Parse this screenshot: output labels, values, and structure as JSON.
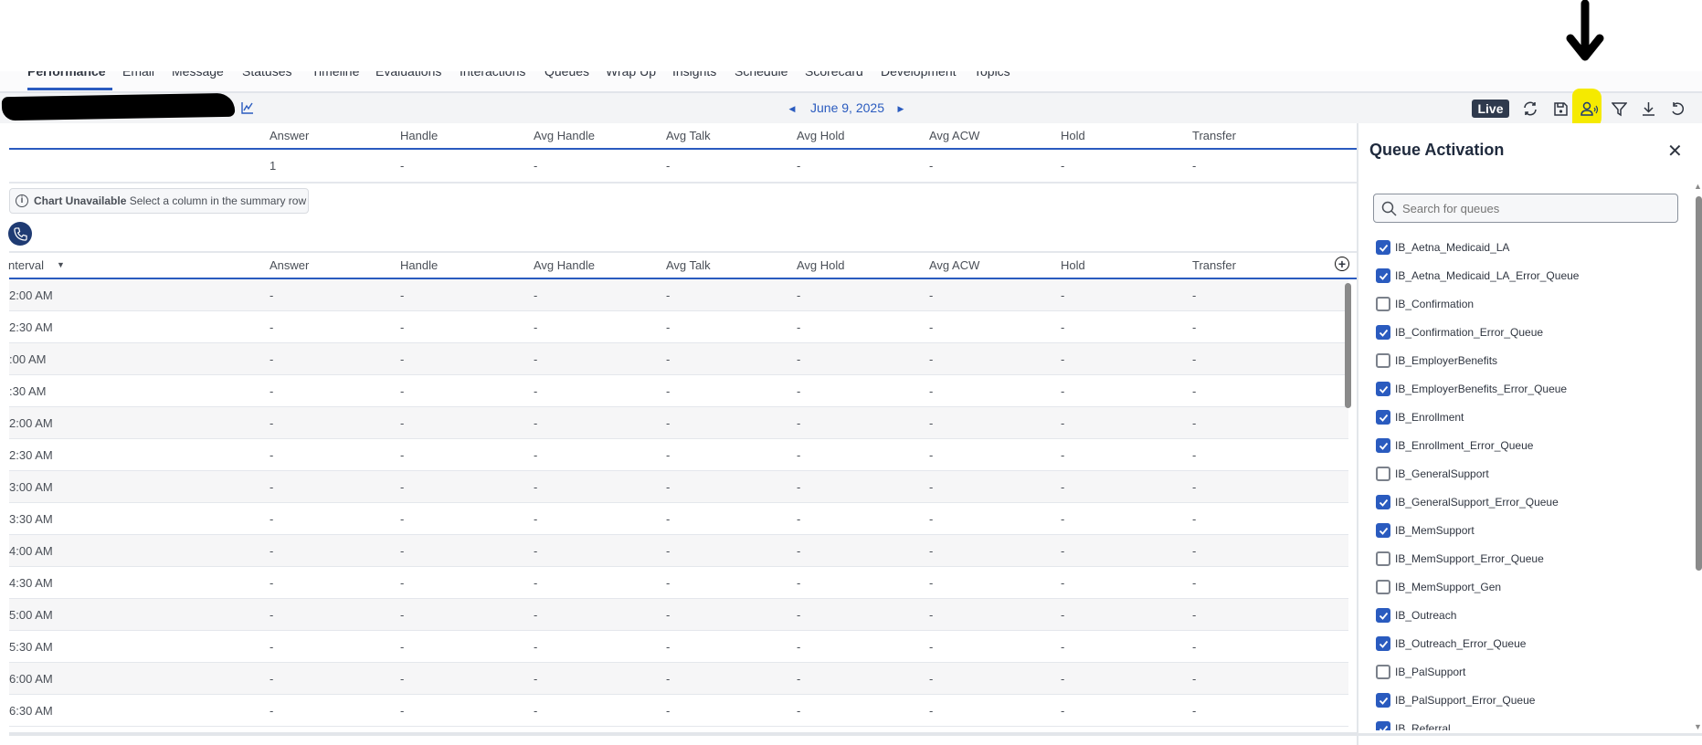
{
  "tabs": [
    "Performance",
    "Email",
    "Message",
    "Statuses",
    "Timeline",
    "Evaluations",
    "Interactions",
    "Queues",
    "Wrap Up",
    "Insights",
    "Schedule",
    "Scorecard",
    "Development",
    "Topics"
  ],
  "toolbar": {
    "date": "June 9, 2025",
    "live": "Live",
    "icons": [
      "refresh-icon",
      "save-icon",
      "queue-activation-icon",
      "filter-icon",
      "download-icon",
      "reset-icon"
    ]
  },
  "columns": [
    "Answer",
    "Handle",
    "Avg Handle",
    "Avg Talk",
    "Avg Hold",
    "Avg ACW",
    "Hold",
    "Transfer"
  ],
  "summary": {
    "values": [
      "1",
      "-",
      "-",
      "-",
      "-",
      "-",
      "-",
      "-"
    ]
  },
  "chart_notice": {
    "title": "Chart Unavailable",
    "text": "Select a column in the summary row"
  },
  "interval": {
    "header": "nterval",
    "rows": [
      {
        "label": "2:00 AM",
        "values": [
          "-",
          "-",
          "-",
          "-",
          "-",
          "-",
          "-",
          "-"
        ]
      },
      {
        "label": "2:30 AM",
        "values": [
          "-",
          "-",
          "-",
          "-",
          "-",
          "-",
          "-",
          "-"
        ]
      },
      {
        "label": ":00 AM",
        "values": [
          "-",
          "-",
          "-",
          "-",
          "-",
          "-",
          "-",
          "-"
        ]
      },
      {
        "label": ":30 AM",
        "values": [
          "-",
          "-",
          "-",
          "-",
          "-",
          "-",
          "-",
          "-"
        ]
      },
      {
        "label": "2:00 AM",
        "values": [
          "-",
          "-",
          "-",
          "-",
          "-",
          "-",
          "-",
          "-"
        ]
      },
      {
        "label": "2:30 AM",
        "values": [
          "-",
          "-",
          "-",
          "-",
          "-",
          "-",
          "-",
          "-"
        ]
      },
      {
        "label": "3:00 AM",
        "values": [
          "-",
          "-",
          "-",
          "-",
          "-",
          "-",
          "-",
          "-"
        ]
      },
      {
        "label": "3:30 AM",
        "values": [
          "-",
          "-",
          "-",
          "-",
          "-",
          "-",
          "-",
          "-"
        ]
      },
      {
        "label": "4:00 AM",
        "values": [
          "-",
          "-",
          "-",
          "-",
          "-",
          "-",
          "-",
          "-"
        ]
      },
      {
        "label": "4:30 AM",
        "values": [
          "-",
          "-",
          "-",
          "-",
          "-",
          "-",
          "-",
          "-"
        ]
      },
      {
        "label": "5:00 AM",
        "values": [
          "-",
          "-",
          "-",
          "-",
          "-",
          "-",
          "-",
          "-"
        ]
      },
      {
        "label": "5:30 AM",
        "values": [
          "-",
          "-",
          "-",
          "-",
          "-",
          "-",
          "-",
          "-"
        ]
      },
      {
        "label": "6:00 AM",
        "values": [
          "-",
          "-",
          "-",
          "-",
          "-",
          "-",
          "-",
          "-"
        ]
      },
      {
        "label": "6:30 AM",
        "values": [
          "-",
          "-",
          "-",
          "-",
          "-",
          "-",
          "-",
          "-"
        ]
      }
    ]
  },
  "panel": {
    "title": "Queue Activation",
    "search_placeholder": "Search for queues",
    "queues": [
      {
        "name": "IB_Aetna_Medicaid_LA",
        "checked": true
      },
      {
        "name": "IB_Aetna_Medicaid_LA_Error_Queue",
        "checked": true
      },
      {
        "name": "IB_Confirmation",
        "checked": false
      },
      {
        "name": "IB_Confirmation_Error_Queue",
        "checked": true
      },
      {
        "name": "IB_EmployerBenefits",
        "checked": false
      },
      {
        "name": "IB_EmployerBenefits_Error_Queue",
        "checked": true
      },
      {
        "name": "IB_Enrollment",
        "checked": true
      },
      {
        "name": "IB_Enrollment_Error_Queue",
        "checked": true
      },
      {
        "name": "IB_GeneralSupport",
        "checked": false
      },
      {
        "name": "IB_GeneralSupport_Error_Queue",
        "checked": true
      },
      {
        "name": "IB_MemSupport",
        "checked": true
      },
      {
        "name": "IB_MemSupport_Error_Queue",
        "checked": false
      },
      {
        "name": "IB_MemSupport_Gen",
        "checked": false
      },
      {
        "name": "IB_Outreach",
        "checked": true
      },
      {
        "name": "IB_Outreach_Error_Queue",
        "checked": true
      },
      {
        "name": "IB_PalSupport",
        "checked": false
      },
      {
        "name": "IB_PalSupport_Error_Queue",
        "checked": true
      },
      {
        "name": "IB_Referral",
        "checked": true
      }
    ]
  },
  "colors": {
    "accent": "#2a5bbf",
    "live_badge": "#2f3a4d",
    "highlight": "#f5ea00"
  }
}
